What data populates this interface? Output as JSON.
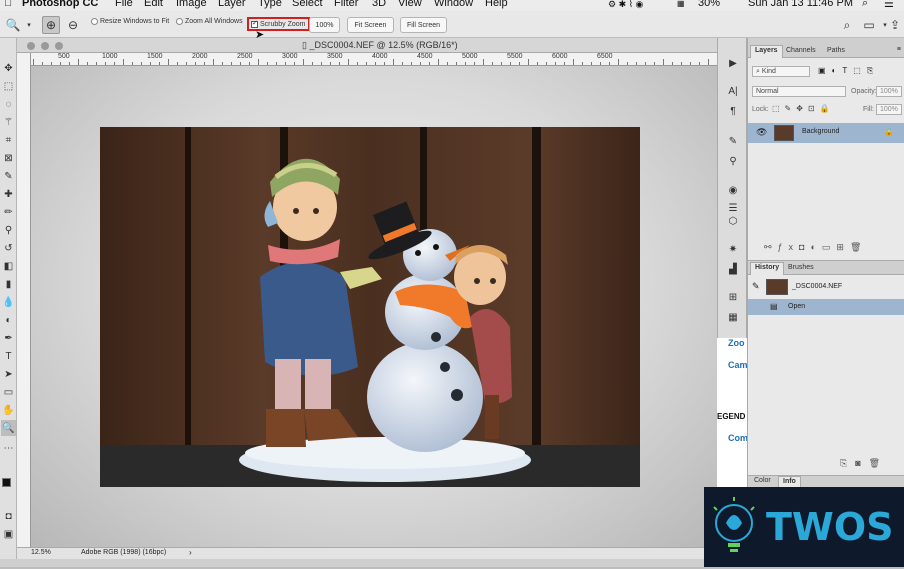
{
  "menubar": {
    "app": "Photoshop CC",
    "items": [
      "File",
      "Edit",
      "Image",
      "Layer",
      "Type",
      "Select",
      "Filter",
      "3D",
      "View",
      "Window",
      "Help"
    ],
    "battery": "30%",
    "clock": "Sun Jan 13  11:46 PM"
  },
  "options": {
    "resize_windows": "Resize Windows to Fit",
    "zoom_all": "Zoom All Windows",
    "scrubby_zoom": "Scrubby Zoom",
    "btn_100": "100%",
    "fit_screen": "Fit Screen",
    "fill_screen": "Fill Screen"
  },
  "document": {
    "title": "_DSC0004.NEF @ 12.5% (RGB/16*)",
    "ruler_labels": [
      "500",
      "1000",
      "1500",
      "2000",
      "2500",
      "3000",
      "3500",
      "4000",
      "4500",
      "5000",
      "5500",
      "6000",
      "6500"
    ],
    "zoom": "12.5%",
    "color_profile": "Adobe RGB (1998) (16bpc)"
  },
  "background_window": {
    "items": [
      "Zoo",
      "Cam",
      "EGEND",
      "Com"
    ]
  },
  "layers_panel": {
    "tabs": [
      "Layers",
      "Channels",
      "Paths"
    ],
    "kind": "Kind",
    "blend_mode": "Normal",
    "opacity_label": "Opacity:",
    "opacity_value": "100%",
    "lock_label": "Lock:",
    "fill_label": "Fill:",
    "fill_value": "100%",
    "layer_name": "Background"
  },
  "history_panel": {
    "tabs": [
      "History",
      "Brushes"
    ],
    "snapshot": "_DSC0004.NEF",
    "state": "Open"
  },
  "color_panel": {
    "tabs": [
      "Color",
      "Info"
    ]
  },
  "watermark": {
    "text": "TWOS"
  },
  "colors": {
    "selection_blue": "#9db5cf",
    "highlight_red": "#d21f1f",
    "watermark_bg": "#0e1a2b"
  }
}
